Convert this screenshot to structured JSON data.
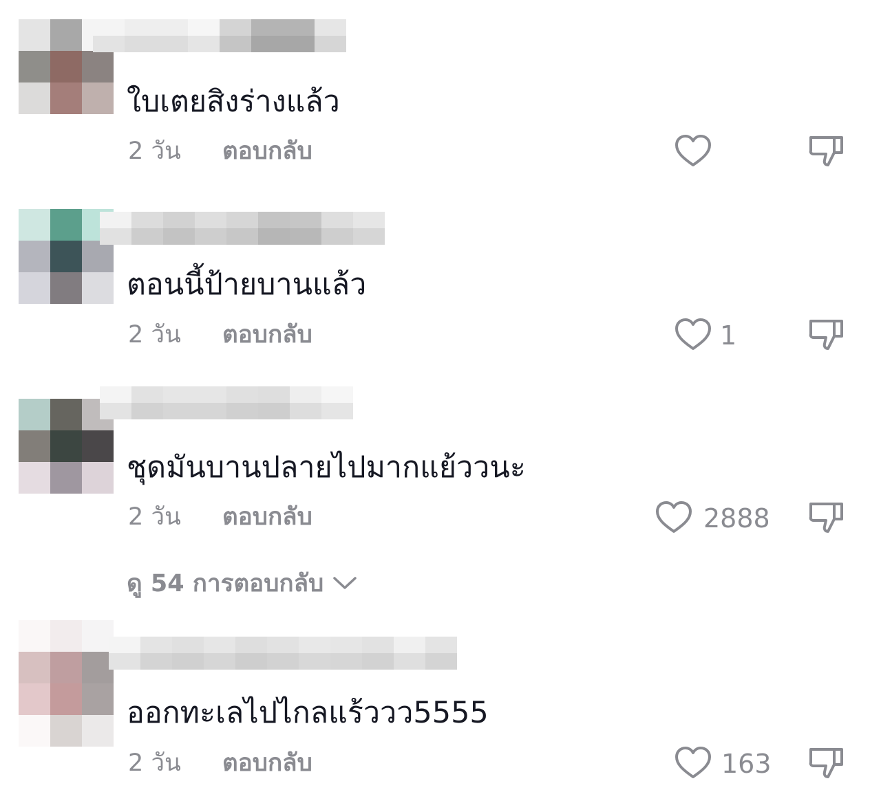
{
  "comments": [
    {
      "text": "ใบเตยสิงร่างแล้ว",
      "time": "2 วัน",
      "reply_label": "ตอบกลับ",
      "likes": "",
      "avatar_colors": [
        "#e4e4e4",
        "#a8a8a8",
        "#f4f4f4",
        "#8f8e8a",
        "#8e6a64",
        "#8b8381",
        "#dcdbda",
        "#a47e7a",
        "#bfb0ad"
      ],
      "username_colors": [
        "#f4f4f4",
        "#eeeeee",
        "#eeeeee",
        "#f6f6f6",
        "#d4d4d4",
        "#b4b4b4",
        "#b4b4b4",
        "#e6e6e6"
      ]
    },
    {
      "text": "ตอนนี้ป้ายบานแล้ว",
      "time": "2 วัน",
      "reply_label": "ตอบกลับ",
      "likes": "1",
      "avatar_colors": [
        "#cfe7e1",
        "#5c9f8c",
        "#bde3da",
        "#b4b5bd",
        "#3d5458",
        "#a8a9b0",
        "#d5d5dc",
        "#817c80",
        "#dcdce0"
      ],
      "username_colors": [
        "#f2f2f2",
        "#dcdcdc",
        "#d2d2d2",
        "#dedede",
        "#d6d6d6",
        "#c4c4c4",
        "#c6c6c6",
        "#dedede",
        "#e6e6e6"
      ]
    },
    {
      "text": "ชุดมันบานปลายไปมากแย้ววนะ",
      "time": "2 วัน",
      "reply_label": "ตอบกลับ",
      "likes": "2888",
      "avatar_colors": [
        "#b4cdc8",
        "#66655f",
        "#c0bcbc",
        "#827e79",
        "#3c4641",
        "#4a4749",
        "#e5dce1",
        "#9f97a0",
        "#ddd3d9"
      ],
      "username_colors": [
        "#f4f4f4",
        "#e2e2e2",
        "#e6e6e6",
        "#e6e6e6",
        "#e0e0e0",
        "#dedede",
        "#eeeeee",
        "#f6f6f6"
      ]
    },
    {
      "text": "ออกทะเลไปไกลแร้ววว5555",
      "time": "2 วัน",
      "reply_label": "ตอบกลับ",
      "likes": "163",
      "avatar_colors": [
        "#faf7f7",
        "#f2eced",
        "#f5f4f5",
        "#d7c0c0",
        "#bf9ea0",
        "#a39d9d",
        "#e3c8ca",
        "#c49b9c",
        "#a9a2a2",
        "#fbf8f8",
        "#d9d4d2",
        "#ebe9e9"
      ],
      "username_colors": [
        "#f4f4f4",
        "#e4e4e4",
        "#e0e0e0",
        "#e6e6e6",
        "#dedede",
        "#e2e2e2",
        "#e8e8e8",
        "#e6e6e6",
        "#e2e2e2",
        "#f0f0f0",
        "#e4e4e4"
      ]
    }
  ],
  "view_replies": "ดู 54 การตอบกลับ",
  "icons": {
    "like": "heart-outline-icon",
    "dislike": "thumbs-down-icon",
    "expand": "chevron-down-icon"
  }
}
